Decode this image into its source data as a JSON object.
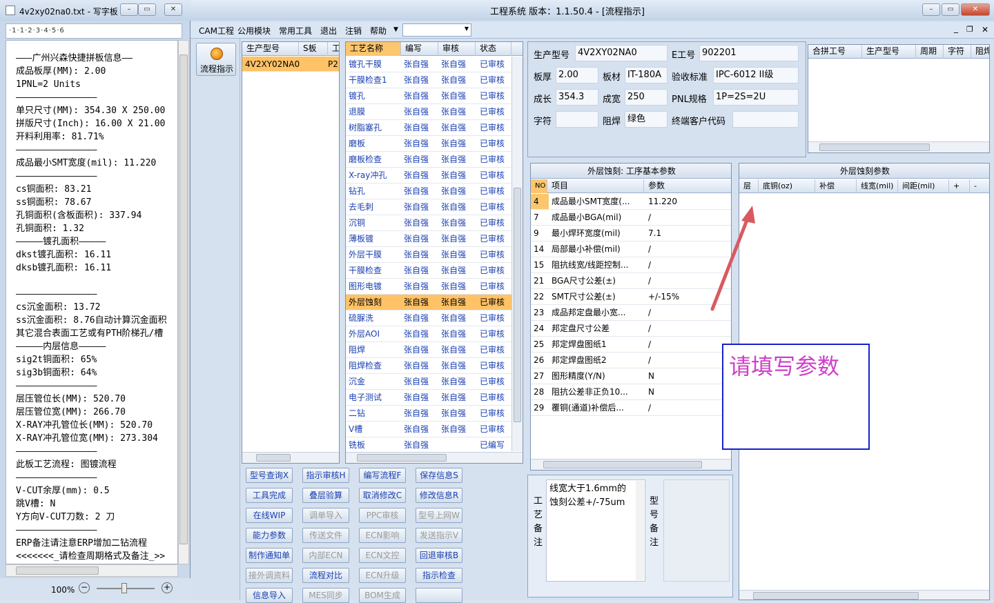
{
  "wordpad": {
    "title": "4v2xy02na0.txt - 写字板",
    "ruler": "·1·1·2·3·4·5·6",
    "zoom": "100%",
    "lines": [
      "———广州兴森快捷拼板信息——",
      "成品板厚(MM): 2.00",
      "1PNL=2 Units",
      "———————————————",
      "单只尺寸(MM): 354.30 X 250.00",
      "拼版尺寸(Inch): 16.00 X 21.00",
      "开料利用率: 81.71%",
      "———————————————",
      "成品最小SMT宽度(mil): 11.220",
      "———————————————",
      "cs铜面积: 83.21",
      "ss铜面积: 78.67",
      "孔铜面积(含板面积): 337.94",
      "孔铜面积: 1.32",
      "—————镀孔面积—————",
      "dkst镀孔面积: 16.11",
      "dksb镀孔面积: 16.11",
      "",
      "———————————————",
      "cs沉金面积: 13.72",
      "ss沉金面积: 8.76自动计算沉金面积",
      "其它混合表面工艺或有PTH阶梯孔/槽",
      "—————内层信息—————",
      "sig2t铜面积: 65%",
      "sig3b铜面积: 64%",
      "———————————————",
      "层压管位长(MM): 520.70",
      "层压管位宽(MM): 266.70",
      "X-RAY冲孔管位长(MM): 520.70",
      "X-RAY冲孔管位宽(MM): 273.304",
      "———————————————",
      "此板工艺流程: 图镀流程",
      "———————————————",
      "V-CUT余厚(mm): 0.5",
      "跳V槽: N",
      "Y方向V-CUT刀数: 2 刀",
      "———————————————",
      "ERP备注请注意ERP增加二钻流程",
      "<<<<<<<_请检查周期格式及备注_>>"
    ]
  },
  "app": {
    "title": "工程系统  版本：1.1.50.4 - [流程指示]",
    "menu": [
      "CAM工程",
      "公用模块",
      "常用工具",
      "退出",
      "注销",
      "帮助"
    ],
    "flow_button": "流程指示",
    "models": {
      "headers": [
        "生产型号",
        "S板",
        "工"
      ],
      "rows": [
        [
          "4V2XY02NA0",
          "P2",
          ""
        ]
      ]
    },
    "process": {
      "headers": [
        "工艺名称",
        "编写",
        "审核",
        "状态"
      ],
      "rows": [
        [
          "镀孔干膜",
          "张自强",
          "张自强",
          "已审核"
        ],
        [
          "干膜检查1",
          "张自强",
          "张自强",
          "已审核"
        ],
        [
          "镀孔",
          "张自强",
          "张自强",
          "已审核"
        ],
        [
          "退膜",
          "张自强",
          "张自强",
          "已审核"
        ],
        [
          "树脂塞孔",
          "张自强",
          "张自强",
          "已审核"
        ],
        [
          "磨板",
          "张自强",
          "张自强",
          "已审核"
        ],
        [
          "磨板检查",
          "张自强",
          "张自强",
          "已审核"
        ],
        [
          "X-ray冲孔",
          "张自强",
          "张自强",
          "已审核"
        ],
        [
          "钻孔",
          "张自强",
          "张自强",
          "已审核"
        ],
        [
          "去毛刺",
          "张自强",
          "张自强",
          "已审核"
        ],
        [
          "沉铜",
          "张自强",
          "张自强",
          "已审核"
        ],
        [
          "薄板镀",
          "张自强",
          "张自强",
          "已审核"
        ],
        [
          "外层干膜",
          "张自强",
          "张自强",
          "已审核"
        ],
        [
          "干膜检查",
          "张自强",
          "张自强",
          "已审核"
        ],
        [
          "图形电镀",
          "张自强",
          "张自强",
          "已审核"
        ],
        [
          "外层蚀刻",
          "张自强",
          "张自强",
          "已审核"
        ],
        [
          "硫脲洗",
          "张自强",
          "张自强",
          "已审核"
        ],
        [
          "外层AOI",
          "张自强",
          "张自强",
          "已审核"
        ],
        [
          "阻焊",
          "张自强",
          "张自强",
          "已审核"
        ],
        [
          "阻焊检查",
          "张自强",
          "张自强",
          "已审核"
        ],
        [
          "沉金",
          "张自强",
          "张自强",
          "已审核"
        ],
        [
          "电子测试",
          "张自强",
          "张自强",
          "已审核"
        ],
        [
          "二钻",
          "张自强",
          "张自强",
          "已审核"
        ],
        [
          "V槽",
          "张自强",
          "张自强",
          "已审核"
        ],
        [
          "铣板",
          "张自强",
          "",
          "已编写"
        ]
      ],
      "selected_index": 15
    },
    "buttons": [
      [
        "型号查询X",
        "指示审核H",
        "编写流程F",
        "保存信息S"
      ],
      [
        "工具完成",
        "叠层验算",
        "取消修改C",
        "修改信息R"
      ],
      [
        "在线WIP",
        "调单导入",
        "PPC审核",
        "型号上网W"
      ],
      [
        "能力参数",
        "传送文件",
        "ECN影响",
        "发送指示V"
      ],
      [
        "制作通知单",
        "内部ECN",
        "ECN文控",
        "回退审核B"
      ],
      [
        "接外调资料",
        "流程对比",
        "ECN升级",
        "指示检查"
      ],
      [
        "信息导入",
        "MES同步",
        "BOM生成",
        ""
      ]
    ],
    "buttons_disabled": [
      [
        false,
        false,
        false,
        false
      ],
      [
        false,
        false,
        false,
        false
      ],
      [
        false,
        true,
        true,
        true
      ],
      [
        false,
        true,
        true,
        true
      ],
      [
        false,
        true,
        true,
        false
      ],
      [
        true,
        false,
        true,
        false
      ],
      [
        false,
        true,
        true,
        false
      ]
    ],
    "info": {
      "prod_model_label": "生产型号",
      "prod_model": "4V2XY02NA0",
      "e_no_label": "E工号",
      "e_no": "902201",
      "thickness_label": "板厚",
      "thickness": "2.00",
      "material_label": "板材",
      "material": "IT-180A",
      "standard_label": "验收标准",
      "standard": "IPC-6012 II级",
      "length_label": "成长",
      "length": "354.3",
      "width_label": "成宽",
      "width": "250",
      "pnl_label": "PNL规格",
      "pnl": "1P=2S=2U",
      "legend_label": "字符",
      "legend": "",
      "mask_label": "阻焊",
      "mask": "绿色",
      "customer_label": "终端客户代码",
      "customer": ""
    },
    "merge": {
      "headers": [
        "合拼工号",
        "生产型号",
        "周期",
        "字符",
        "阻焊"
      ]
    },
    "basic_params": {
      "title": "外层蚀刻: 工序基本参数",
      "headers": [
        "NO",
        "项目",
        "参数"
      ],
      "rows": [
        [
          "4",
          "成品最小SMT宽度(...",
          "11.220"
        ],
        [
          "7",
          "成品最小BGA(mil)",
          "/"
        ],
        [
          "9",
          "最小焊环宽度(mil)",
          "7.1"
        ],
        [
          "14",
          "局部最小补偿(mil)",
          "/"
        ],
        [
          "15",
          "阻抗线宽/线距控制...",
          "/"
        ],
        [
          "21",
          "BGA尺寸公差(±)",
          "/"
        ],
        [
          "22",
          "SMT尺寸公差(±)",
          "+/-15%"
        ],
        [
          "23",
          "成品邦定盘最小宽...",
          "/"
        ],
        [
          "24",
          "邦定盘尺寸公差",
          "/"
        ],
        [
          "25",
          "邦定焊盘图纸1",
          "/"
        ],
        [
          "26",
          "邦定焊盘图纸2",
          "/"
        ],
        [
          "27",
          "图形精度(Y/N)",
          "N"
        ],
        [
          "28",
          "阻抗公差非正负10...",
          "N"
        ],
        [
          "29",
          "覆铜(通道)补偿后...",
          "/"
        ]
      ]
    },
    "etch_params": {
      "title": "外层蚀刻参数",
      "headers": [
        "层",
        "底铜(oz)",
        "补偿",
        "线宽(mil)",
        "间距(mil)",
        "+",
        "-"
      ]
    },
    "annotation": "请填写参数",
    "remark": {
      "label": "工艺备注",
      "text": "线宽大于1.6mm的蚀刻公差+/-75um",
      "model_label": "型号备注"
    }
  }
}
